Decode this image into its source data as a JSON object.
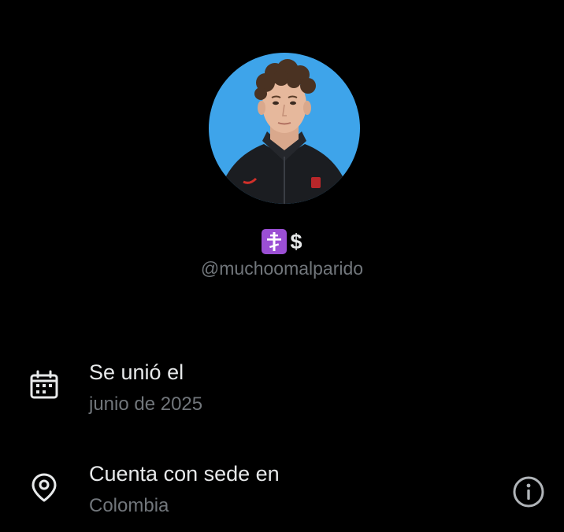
{
  "profile": {
    "display_name": "$",
    "name_emoji": "orthodox-cross-emoji",
    "handle": "@muchoomalparido"
  },
  "info": {
    "joined": {
      "icon": "calendar-icon",
      "title": "Se unió el",
      "value": "junio de 2025"
    },
    "location": {
      "icon": "location-pin-icon",
      "title": "Cuenta con sede en",
      "value": "Colombia",
      "action_icon": "info-icon"
    }
  },
  "colors": {
    "background": "#000000",
    "primary_text": "#e7e9ea",
    "secondary_text": "#71767b",
    "avatar_background": "#3ea4ea",
    "emoji_badge": "#9b4fd4"
  }
}
